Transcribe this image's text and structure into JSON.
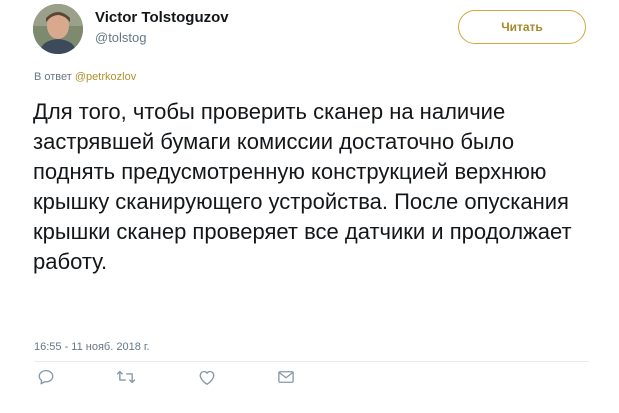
{
  "author": {
    "display_name": "Victor Tolstoguzov",
    "username": "@tolstog"
  },
  "follow_button": {
    "label": "Читать"
  },
  "reply_context": {
    "prefix": "В ответ",
    "mention": "@petrkozlov"
  },
  "tweet": {
    "text": "Для того, чтобы проверить сканер на наличие застрявшей бумаги комиссии достаточно было поднять предусмотренную конструкцией верхнюю крышку сканирующего устройства. После опускания крышки сканер проверяет все датчики и продолжает работу.",
    "timestamp": "16:55 - 11 нояб. 2018 г."
  },
  "actions": [
    {
      "name": "reply",
      "icon": "reply-icon"
    },
    {
      "name": "retweet",
      "icon": "retweet-icon"
    },
    {
      "name": "like",
      "icon": "heart-icon"
    },
    {
      "name": "message",
      "icon": "envelope-icon"
    }
  ],
  "colors": {
    "accent": "#d3a83a",
    "muted_text": "#657786",
    "icon": "#8899a6"
  }
}
